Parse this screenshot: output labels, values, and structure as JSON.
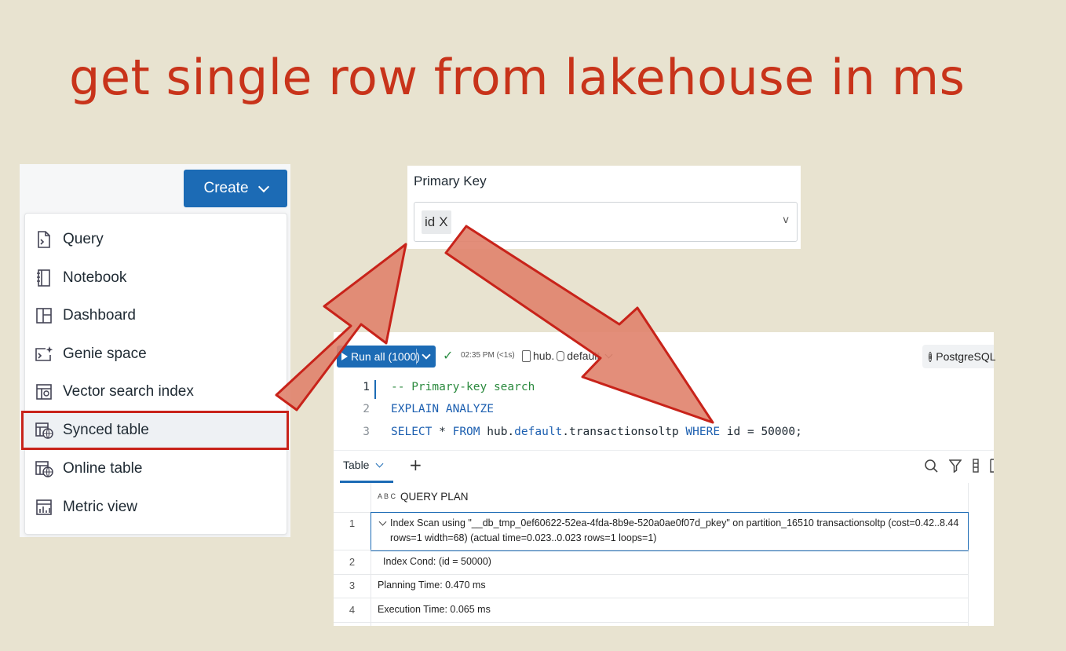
{
  "slide": {
    "title": "get single row from lakehouse in ms"
  },
  "create_menu": {
    "button_label": "Create",
    "items": [
      {
        "label": "Query",
        "icon": "query-file-icon"
      },
      {
        "label": "Notebook",
        "icon": "notebook-icon"
      },
      {
        "label": "Dashboard",
        "icon": "dashboard-icon"
      },
      {
        "label": "Genie space",
        "icon": "genie-space-icon"
      },
      {
        "label": "Vector search index",
        "icon": "vector-search-icon"
      },
      {
        "label": "Synced table",
        "icon": "synced-table-icon",
        "highlighted": true
      },
      {
        "label": "Online table",
        "icon": "online-table-icon"
      },
      {
        "label": "Metric view",
        "icon": "metric-view-icon"
      }
    ]
  },
  "primary_key": {
    "label": "Primary Key",
    "chip_value": "id",
    "chip_remove": "X",
    "caret": "v"
  },
  "editor": {
    "run_label": "Run all (1000)",
    "run_time": "02:35 PM (<1s)",
    "catalog": "hub.",
    "schema": "default",
    "engine": "PostgreSQL",
    "lines": [
      {
        "num": "1",
        "comment": "-- Primary-key search"
      },
      {
        "num": "2",
        "kw": "EXPLAIN ANALYZE"
      },
      {
        "num": "3",
        "kw1": "SELECT",
        "t1": " * ",
        "kw2": "FROM",
        "t2": " hub.",
        "kw3": "default",
        "t3": ".transactionsoltp ",
        "kw4": "WHERE",
        "t4": " id = 50000;"
      }
    ]
  },
  "results": {
    "tab_label": "Table",
    "add_tab": "+",
    "column_header": "QUERY PLAN",
    "abc_icon_text": "A B C",
    "rows": [
      {
        "num": "1",
        "text_1": "Index Scan using \"__db_tmp_0ef60622-52ea-4fda-8b9e-520a0ae0f07d_pkey\" on partition_16510 transactionsoltp  (cost=0.42..8.44",
        "text_2": "rows=1 width=68) (actual time=0.023..0.023 rows=1 loops=1)"
      },
      {
        "num": "2",
        "text": "Index Cond: (id = 50000)"
      },
      {
        "num": "3",
        "text": "Planning Time: 0.470 ms"
      },
      {
        "num": "4",
        "text": "Execution Time: 0.065 ms"
      }
    ]
  },
  "colors": {
    "accent": "#1c6bb5",
    "highlight": "#c8231a",
    "title": "#c8331a",
    "arrow_fill": "#e0826c"
  }
}
